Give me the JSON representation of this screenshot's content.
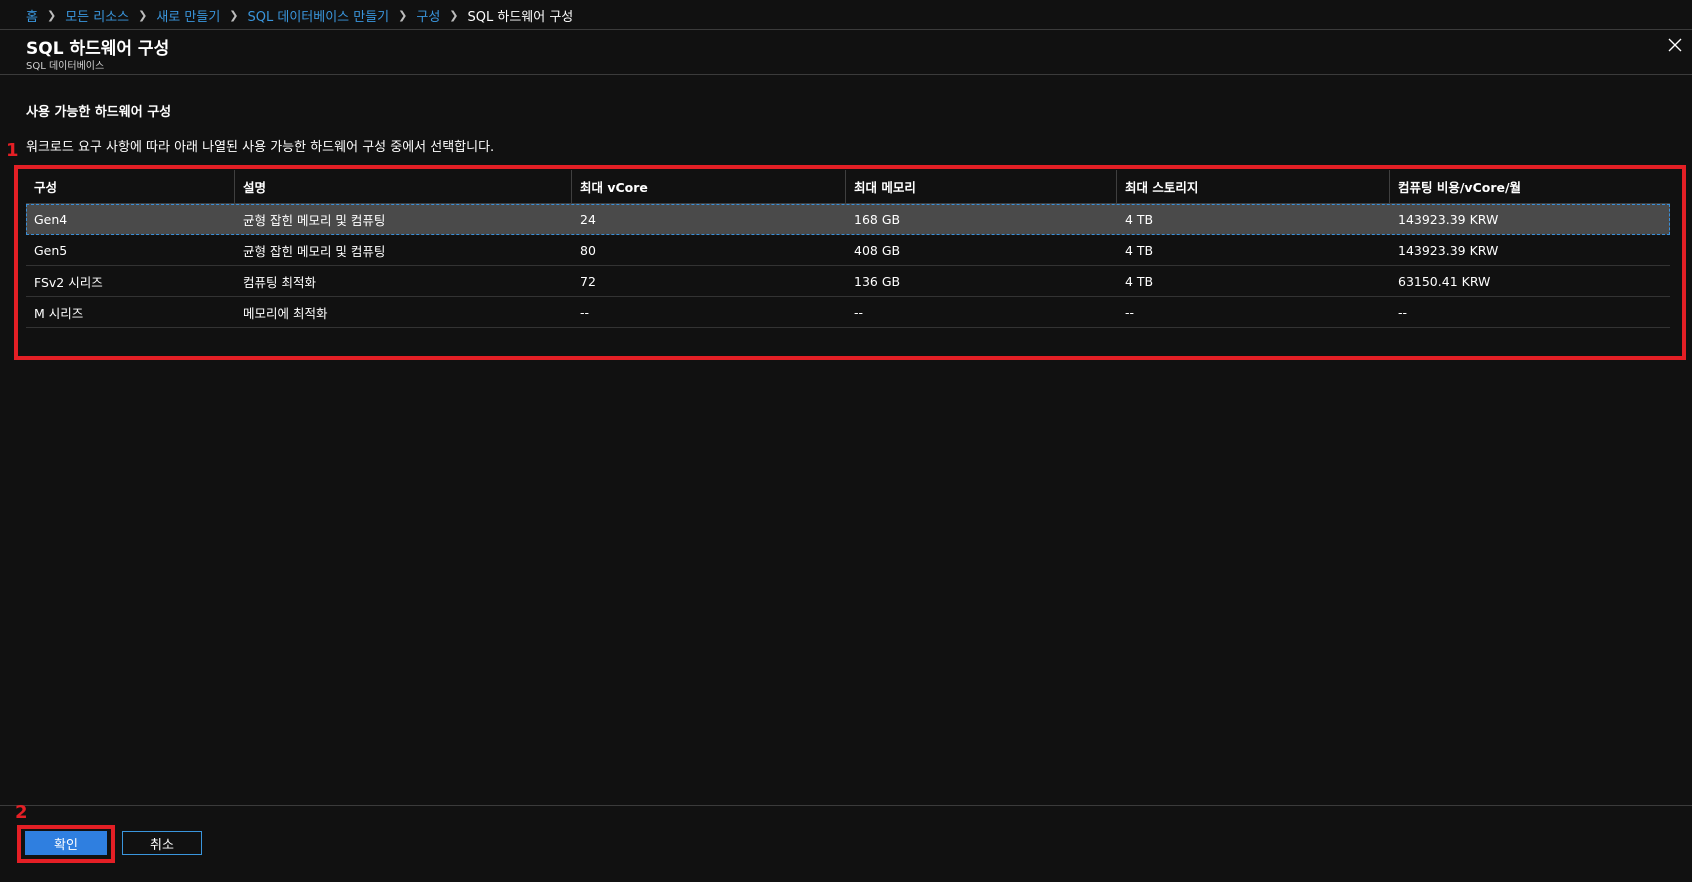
{
  "breadcrumb": {
    "items": [
      "홈",
      "모든 리소스",
      "새로 만들기",
      "SQL 데이터베이스 만들기",
      "구성"
    ],
    "current": "SQL 하드웨어 구성"
  },
  "blade": {
    "title": "SQL 하드웨어 구성",
    "subtitle": "SQL 데이터베이스"
  },
  "section": {
    "title": "사용 가능한 하드웨어 구성",
    "description": "워크로드 요구 사항에 따라 아래 나열된 사용 가능한 하드웨어 구성 중에서 선택합니다."
  },
  "annotations": {
    "one": "1",
    "two": "2",
    "color": "#e41f25"
  },
  "table": {
    "columns": [
      "구성",
      "설명",
      "최대 vCore",
      "최대 메모리",
      "최대 스토리지",
      "컴퓨팅 비용/vCore/월"
    ],
    "rows": [
      [
        "Gen4",
        "균형 잡힌 메모리 및 컴퓨팅",
        "24",
        "168 GB",
        "4 TB",
        "143923.39 KRW"
      ],
      [
        "Gen5",
        "균형 잡힌 메모리 및 컴퓨팅",
        "80",
        "408 GB",
        "4 TB",
        "143923.39 KRW"
      ],
      [
        "FSv2 시리즈",
        "컴퓨팅 최적화",
        "72",
        "136 GB",
        "4 TB",
        "63150.41 KRW"
      ],
      [
        "M 시리즈",
        "메모리에 최적화",
        "--",
        "--",
        "--",
        "--"
      ]
    ],
    "selected_row": "Gen4"
  },
  "footer": {
    "ok_label": "확인",
    "cancel_label": "취소"
  },
  "icons": {
    "close": "close-icon",
    "separator": "chevron-right-icon"
  },
  "colors": {
    "background": "#111111",
    "link": "#3a96dd",
    "primary_button": "#2f7fe0",
    "annotation": "#e41f25"
  }
}
